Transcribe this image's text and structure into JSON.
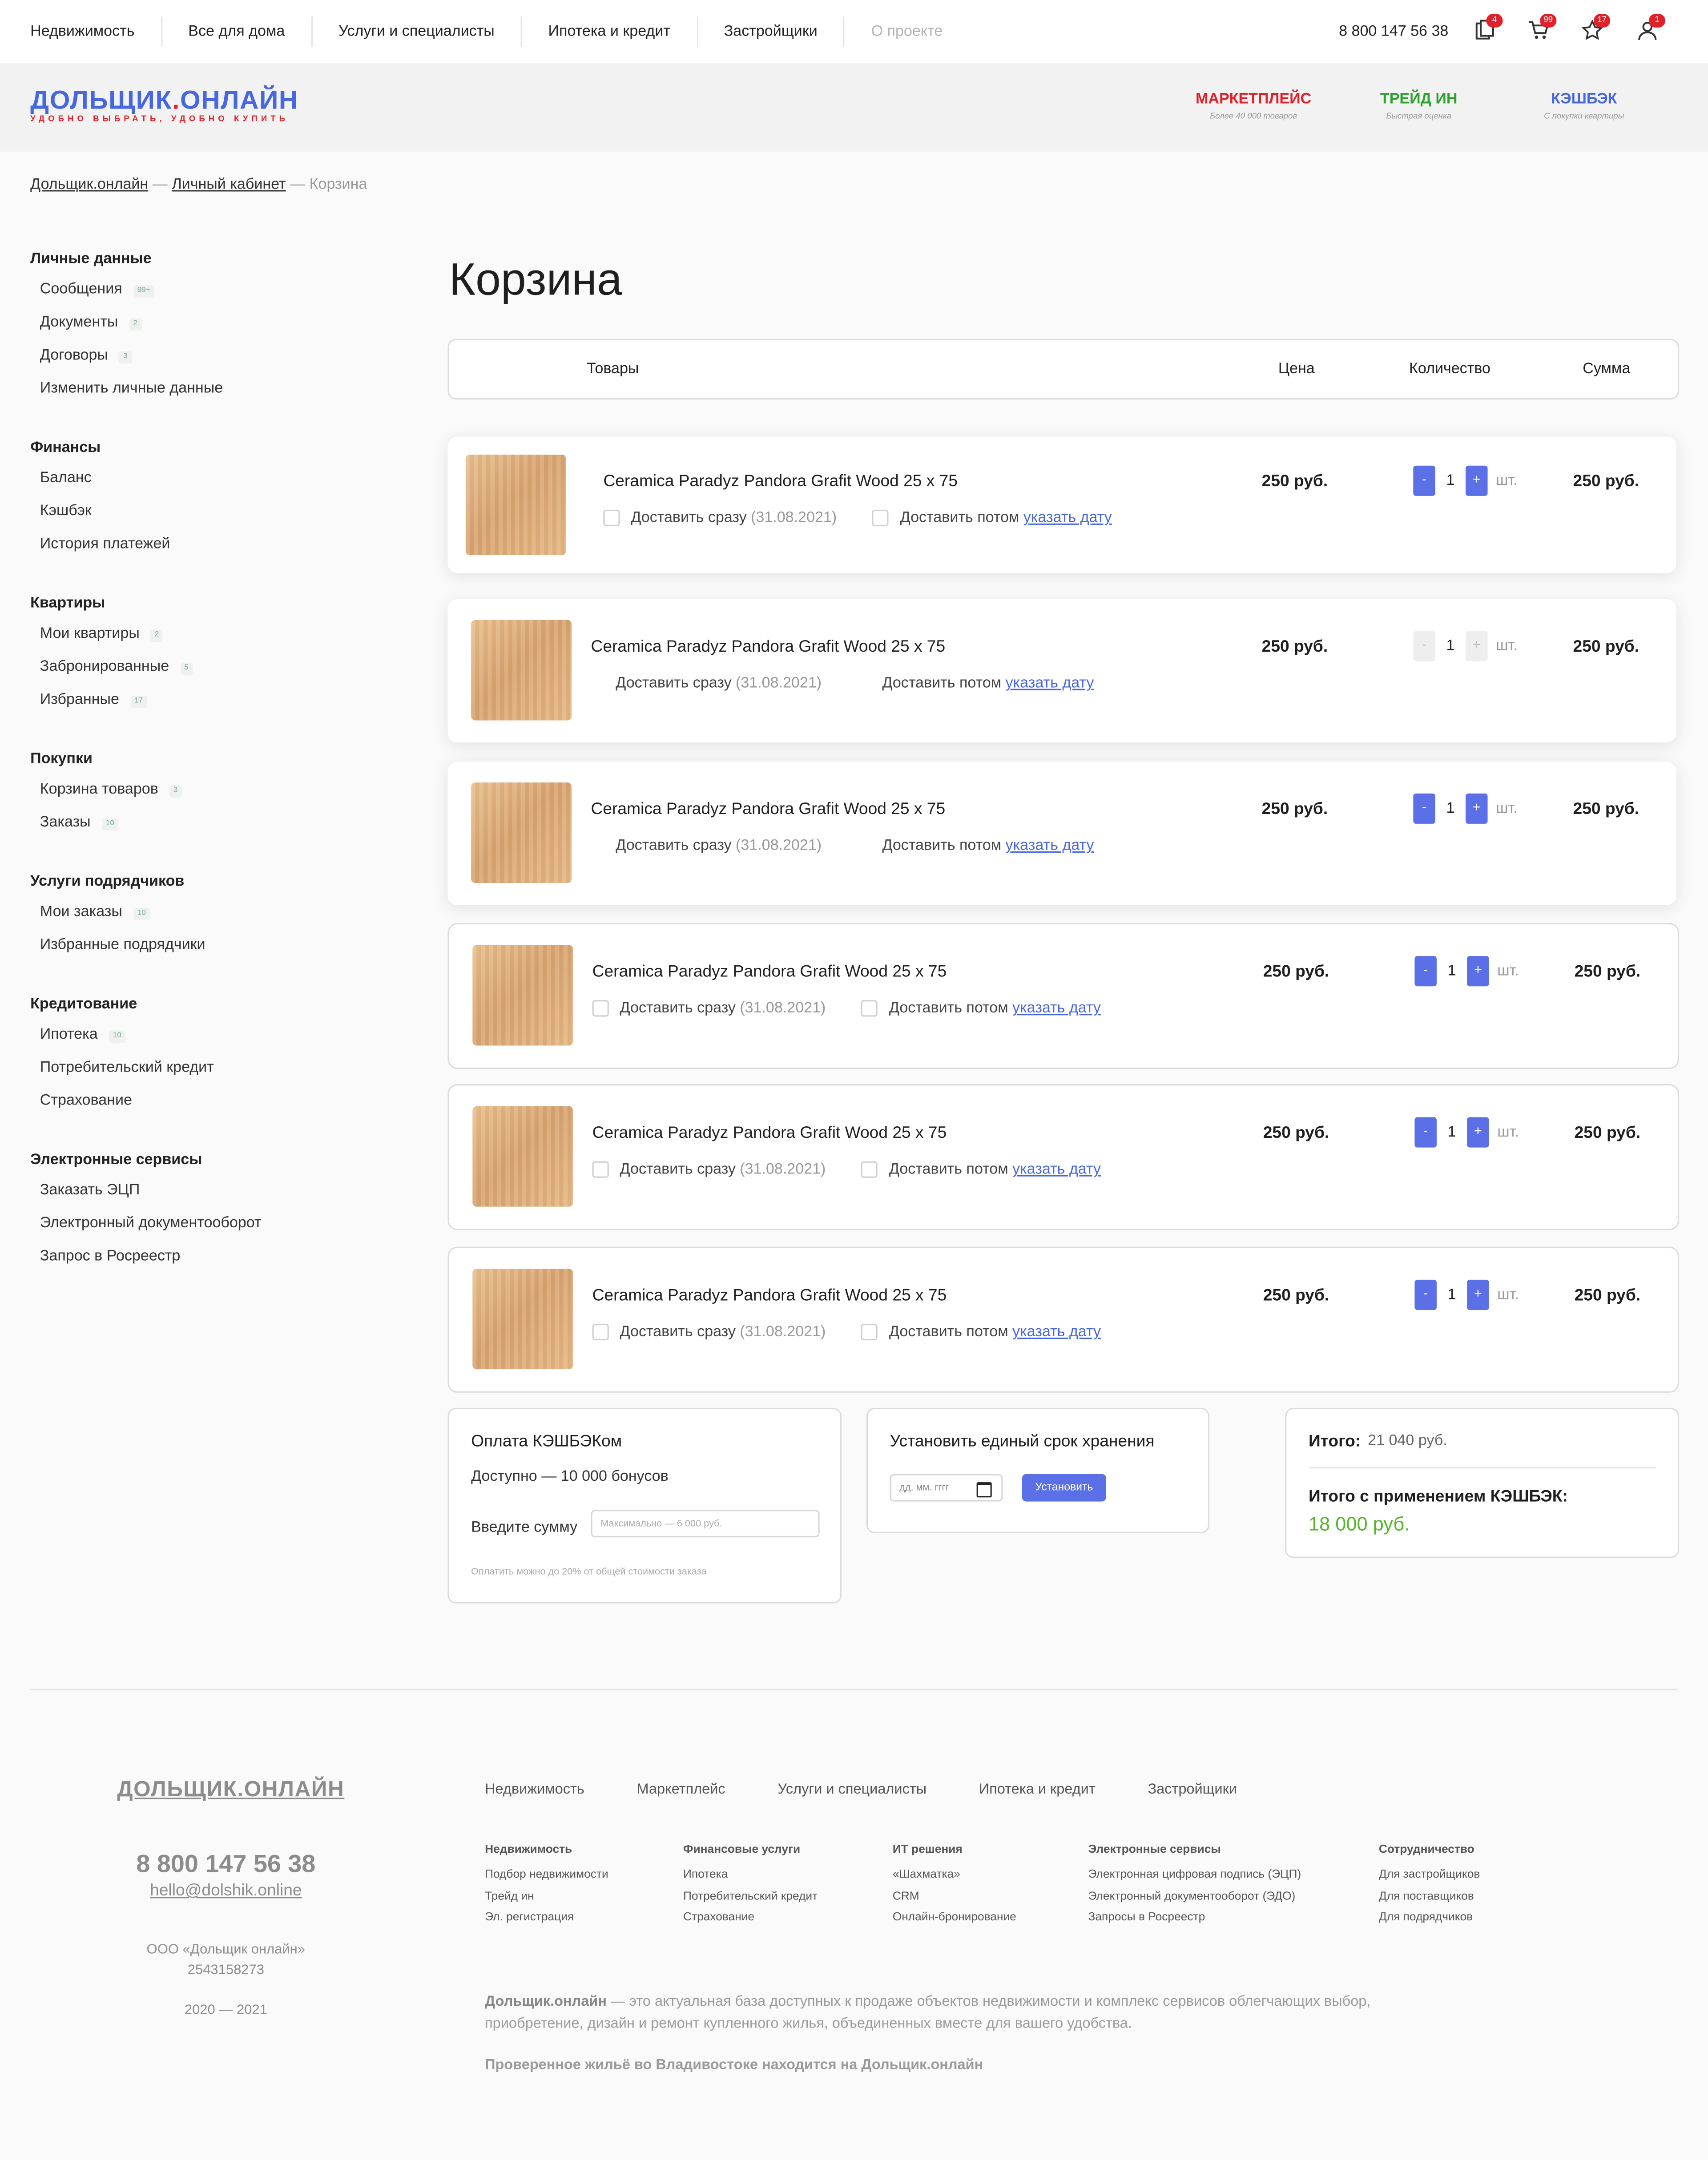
{
  "topnav": {
    "items": [
      "Недвижимость",
      "Все для дома",
      "Услуги и специалисты",
      "Ипотека и кредит",
      "Застройщики"
    ],
    "muted_item": "О проекте",
    "phone": "8 800 147 56 38",
    "badges": [
      "4",
      "99",
      "17",
      "1"
    ]
  },
  "brand": {
    "logo_left": "ДОЛЬЩИК",
    "logo_dot": ".",
    "logo_right": "ОНЛАЙН",
    "tagline": "УДОБНО ВЫБРАТЬ, УДОБНО КУПИТЬ",
    "promos": [
      {
        "title": "МАРКЕТПЛЕЙС",
        "subtitle": "Более 40 000 товаров",
        "color": "#e0212a"
      },
      {
        "title": "ТРЕЙД ИН",
        "subtitle": "Быстрая оценка",
        "color": "#2ea12e"
      },
      {
        "title": "КЭШБЭК",
        "subtitle": "С покупки квартиры",
        "color": "#4767e0"
      }
    ]
  },
  "breadcrumb": {
    "home": "Дольщик.онлайн",
    "sep1": "—",
    "cabinet": "Личный кабинет",
    "sep2": "—",
    "current": "Корзина"
  },
  "sidebar": {
    "groups": [
      {
        "title": "Личные данные",
        "items": [
          {
            "label": "Сообщения",
            "count": "99+"
          },
          {
            "label": "Документы",
            "count": "2"
          },
          {
            "label": "Договоры",
            "count": "3"
          },
          {
            "label": "Изменить личные данные",
            "count": ""
          }
        ]
      },
      {
        "title": "Финансы",
        "items": [
          {
            "label": "Баланс",
            "count": ""
          },
          {
            "label": "Кэшбэк",
            "count": ""
          },
          {
            "label": "История платежей",
            "count": ""
          }
        ]
      },
      {
        "title": "Квартиры",
        "items": [
          {
            "label": "Мои квартиры",
            "count": "2"
          },
          {
            "label": "Забронированные",
            "count": "5"
          },
          {
            "label": "Избранные",
            "count": "17"
          }
        ]
      },
      {
        "title": "Покупки",
        "items": [
          {
            "label": "Корзина товаров",
            "count": "3"
          },
          {
            "label": "Заказы",
            "count": "10"
          }
        ]
      },
      {
        "title": "Услуги подрядчиков",
        "items": [
          {
            "label": "Мои заказы",
            "count": "10"
          },
          {
            "label": "Избранные подрядчики",
            "count": ""
          }
        ]
      },
      {
        "title": "Кредитование",
        "items": [
          {
            "label": "Ипотека",
            "count": "10"
          },
          {
            "label": "Потребительский кредит",
            "count": ""
          },
          {
            "label": "Страхование",
            "count": ""
          }
        ]
      },
      {
        "title": "Электронные сервисы",
        "items": [
          {
            "label": "Заказать ЭЦП",
            "count": ""
          },
          {
            "label": "Электронный документооборот",
            "count": ""
          },
          {
            "label": "Запрос в Росреестр",
            "count": ""
          }
        ]
      }
    ]
  },
  "cart": {
    "title": "Корзина",
    "headers": {
      "goods": "Товары",
      "price": "Цена",
      "quantity": "Количество",
      "sum": "Сумма"
    },
    "deliver_now": "Доставить сразу",
    "deliver_date": "(31.08.2021)",
    "deliver_later": "Доставить потом",
    "pick_date": "указать дату",
    "unit": "шт.",
    "minus": "-",
    "plus": "+",
    "items": [
      {
        "name": "Ceramica Paradyz Pandora Grafit Wood 25 х 75",
        "price": "250 руб.",
        "qty": "1",
        "sum": "250 руб."
      },
      {
        "name": "Ceramica Paradyz Pandora Grafit Wood 25 х 75",
        "price": "250 руб.",
        "qty": "1",
        "sum": "250 руб."
      },
      {
        "name": "Ceramica Paradyz Pandora Grafit Wood 25 х 75",
        "price": "250 руб.",
        "qty": "1",
        "sum": "250 руб."
      },
      {
        "name": "Ceramica Paradyz Pandora Grafit Wood 25 х 75",
        "price": "250 руб.",
        "qty": "1",
        "sum": "250 руб."
      },
      {
        "name": "Ceramica Paradyz Pandora Grafit Wood 25 х 75",
        "price": "250 руб.",
        "qty": "1",
        "sum": "250 руб."
      },
      {
        "name": "Ceramica Paradyz Pandora Grafit Wood 25 х 75",
        "price": "250 руб.",
        "qty": "1",
        "sum": "250 руб."
      }
    ]
  },
  "cashback_pay": {
    "title": "Оплата КЭШБЭКом",
    "available": "Доступно — 10 000 бонусов",
    "enter_label": "Введите сумму",
    "placeholder": "Максимально — 6 000 руб.",
    "note": "Оплатить можно до 20% от общей стоимости заказа"
  },
  "storage": {
    "title": "Установить единый срок хранения",
    "date_placeholder": "дд. мм. гггг",
    "button": "Установить"
  },
  "totals": {
    "total_label": "Итого:",
    "total_value": "21 040 руб.",
    "with_cashback_label": "Итого с применением КЭШБЭК:",
    "with_cashback_value": "18 000 руб.",
    "accent": "#55b52a"
  },
  "footer": {
    "logo": "ДОЛЬЩИК.ОНЛАЙН",
    "phone": "8 800 147 56 38",
    "email": "hello@dolshik.online",
    "company": "ООО «Дольщик онлайн»",
    "inn": "2543158273",
    "years": "2020 — 2021",
    "nav": [
      "Недвижимость",
      "Маркетплейс",
      "Услуги и специалисты",
      "Ипотека и кредит",
      "Застройщики"
    ],
    "columns": [
      {
        "title": "Недвижимость",
        "items": [
          "Подбор недвижимости",
          "Трейд ин",
          "Эл. регистрация"
        ]
      },
      {
        "title": "Финансовые услуги",
        "items": [
          "Ипотека",
          "Потребительский кредит",
          "Страхование"
        ]
      },
      {
        "title": "ИТ решения",
        "items": [
          "«Шахматка»",
          "CRM",
          "Онлайн-бронирование"
        ]
      },
      {
        "title": "Электронные сервисы",
        "items": [
          "Электронная цифровая подпись (ЭЦП)",
          "Электронный документооборот (ЭДО)",
          "Запросы в Росреестр"
        ]
      },
      {
        "title": "Сотрудничество",
        "items": [
          "Для застройщиков",
          "Для поставщиков",
          "Для подрядчиков"
        ]
      }
    ],
    "desc_bold": "Дольщик.онлайн",
    "desc_rest": " — это актуальная база доступных к продаже объектов недвижимости и комплекс сервисов облегчающих выбор, приобретение, дизайн и ремонт купленного жилья, объединенных вместе для вашего удобства.",
    "slogan": "Проверенное жильё во Владивостоке находится на Дольщик.онлайн"
  }
}
